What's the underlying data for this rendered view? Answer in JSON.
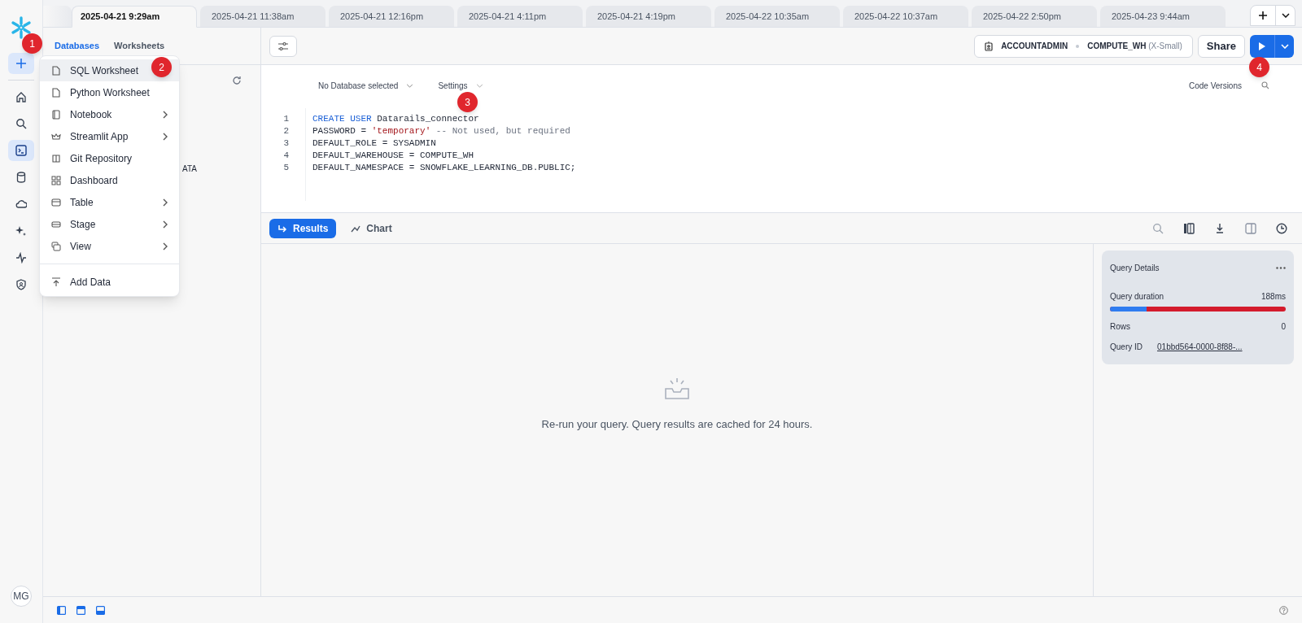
{
  "tabs": [
    {
      "label": "2025-04-21 9:29am",
      "selected": true
    },
    {
      "label": "2025-04-21 11:38am",
      "selected": false
    },
    {
      "label": "2025-04-21 12:16pm",
      "selected": false
    },
    {
      "label": "2025-04-21 4:11pm",
      "selected": false
    },
    {
      "label": "2025-04-21 4:19pm",
      "selected": false
    },
    {
      "label": "2025-04-22 10:35am",
      "selected": false
    },
    {
      "label": "2025-04-22 10:37am",
      "selected": false
    },
    {
      "label": "2025-04-22 2:50pm",
      "selected": false
    },
    {
      "label": "2025-04-23 9:44am",
      "selected": false
    }
  ],
  "rail": {
    "items": [
      {
        "kind": "home",
        "selected": false
      },
      {
        "kind": "search",
        "selected": false
      },
      {
        "kind": "terminal",
        "selected": true
      },
      {
        "kind": "database",
        "selected": false
      },
      {
        "kind": "cloud",
        "selected": false
      },
      {
        "kind": "sparkle",
        "selected": false
      },
      {
        "kind": "activity",
        "selected": false
      },
      {
        "kind": "shield",
        "selected": false
      }
    ],
    "avatar": "MG"
  },
  "panel": {
    "tabs": [
      {
        "label": "Databases",
        "selected": true
      },
      {
        "label": "Worksheets",
        "selected": false
      }
    ],
    "partial_text": "ATA"
  },
  "menu": [
    {
      "label": "SQL Worksheet",
      "kind": "file",
      "submenu": false,
      "selected": true
    },
    {
      "label": "Python Worksheet",
      "kind": "file",
      "submenu": false,
      "selected": false
    },
    {
      "label": "Notebook",
      "kind": "notebook",
      "submenu": true,
      "selected": false
    },
    {
      "label": "Streamlit App",
      "kind": "crown",
      "submenu": true,
      "selected": false
    },
    {
      "label": "Git Repository",
      "kind": "repo",
      "submenu": false,
      "selected": false
    },
    {
      "label": "Dashboard",
      "kind": "grid",
      "submenu": false,
      "selected": false
    },
    {
      "label": "Table",
      "kind": "table",
      "submenu": true,
      "selected": false
    },
    {
      "label": "Stage",
      "kind": "stage",
      "submenu": true,
      "selected": false
    },
    {
      "label": "View",
      "kind": "view",
      "submenu": true,
      "selected": false
    },
    {
      "label": "Add Data",
      "kind": "upload",
      "submenu": false,
      "selected": false
    }
  ],
  "toolbar": {
    "role": "ACCOUNTADMIN",
    "warehouse": "COMPUTE_WH",
    "size": "(X-Small)",
    "share": "Share"
  },
  "editor": {
    "database": "No Database selected",
    "settings": "Settings",
    "code_versions": "Code Versions",
    "lines": [
      {
        "number": "1",
        "code": [
          {
            "kind": "keyword",
            "text": "CREATE USER"
          },
          {
            "kind": "plain",
            "text": " Datarails_connector"
          }
        ]
      },
      {
        "number": "2",
        "code": [
          {
            "kind": "plain",
            "text": "PASSWORD = "
          },
          {
            "kind": "string",
            "text": "'temporary'"
          },
          {
            "kind": "comment",
            "text": " -- Not used, but required"
          }
        ]
      },
      {
        "number": "3",
        "code": [
          {
            "kind": "plain",
            "text": "DEFAULT_ROLE = SYSADMIN"
          }
        ]
      },
      {
        "number": "4",
        "code": [
          {
            "kind": "plain",
            "text": "DEFAULT_WAREHOUSE = COMPUTE_WH"
          }
        ]
      },
      {
        "number": "5",
        "code": [
          {
            "kind": "plain",
            "text": "DEFAULT_NAMESPACE = SNOWFLAKE_LEARNING_DB.PUBLIC;"
          }
        ]
      }
    ]
  },
  "results": {
    "tabs": [
      {
        "label": "Results",
        "selected": true
      },
      {
        "label": "Chart",
        "selected": false
      }
    ],
    "empty_message": "Re-run your query. Query results are cached for 24 hours."
  },
  "query_details": {
    "title": "Query Details",
    "duration_label": "Query duration",
    "duration": "188ms",
    "level": 0.21,
    "rows_label": "Rows",
    "rows": "0",
    "id_label": "Query ID",
    "id": "01bbd564-0000-8f88-..."
  },
  "annotations": [
    "1",
    "2",
    "3",
    "4"
  ]
}
